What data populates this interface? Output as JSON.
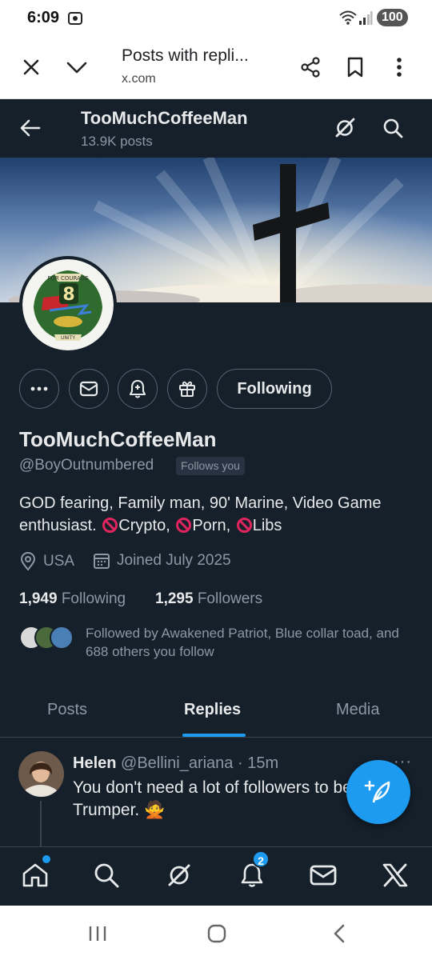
{
  "status_bar": {
    "time": "6:09",
    "battery": "100"
  },
  "browser": {
    "title": "Posts with repli...",
    "url": "x.com"
  },
  "topbar": {
    "name": "TooMuchCoffeeMan",
    "posts_count": "13.9K posts"
  },
  "profile": {
    "display_name": "TooMuchCoffeeMan",
    "handle": "@BoyOutnumbered",
    "follows_you": "Follows you",
    "follow_button": "Following",
    "bio": {
      "line": "GOD fearing, Family man, 90' Marine, Video Game enthusiast.",
      "item1": "Crypto,",
      "item2": "Porn,",
      "item3": "Libs"
    },
    "location": "USA",
    "joined": "Joined July 2025",
    "following_count": "1,949",
    "following_label": "Following",
    "followers_count": "1,295",
    "followers_label": "Followers",
    "followed_by": "Followed by Awakened Patriot, Blue collar toad, and 688 others you follow"
  },
  "tabs": [
    {
      "label": "Posts"
    },
    {
      "label": "Replies",
      "active": true
    },
    {
      "label": "Media"
    }
  ],
  "post": {
    "author_name": "Helen",
    "author_handle": "@Bellini_ariana",
    "time": "· 15m",
    "more": "···",
    "text": "You don't need a lot of followers to be a Trumper. 🙅"
  },
  "bottom_nav": {
    "notifications_badge": "2"
  },
  "colors": {
    "background": "#15202b",
    "accent": "#1d9bf0",
    "text": "#e7e9ea",
    "muted": "#8b98a5",
    "border": "#38444d",
    "ban": "#e0245e"
  }
}
